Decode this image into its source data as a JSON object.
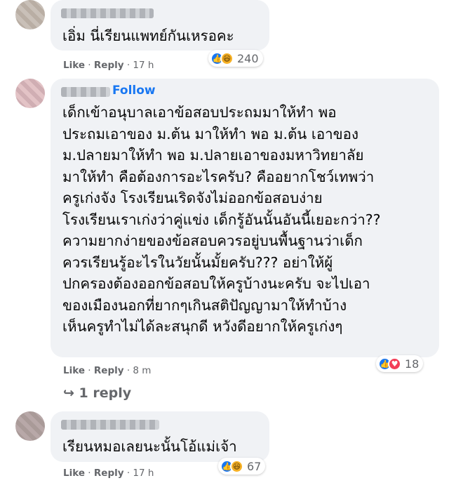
{
  "comments": [
    {
      "text": "เอิ่ม นี่เรียนแพทย์กันเหรอคะ",
      "reaction_count": "240",
      "like_label": "Like",
      "reply_label": "Reply",
      "time": "17 h"
    },
    {
      "follow_label": "Follow",
      "lines": [
        "เด็กเข้าอนุบาลเอาข้อสอบประถมมาให้ทำ พอ",
        "ประถมเอาของ ม.ต้น มาให้ทำ พอ ม.ต้น เอาของ",
        "ม.ปลายมาให้ทำ พอ ม.ปลายเอาของมหาวิทยาลัย",
        "มาให้ทำ คือต้องการอะไรครับ? คืออยากโชว์เทพว่า",
        "ครูเก่งจัง โรงเรียนเริดจังไม่ออกข้อสอบง่าย",
        "โรงเรียนเราเก่งว่าคู่แข่ง เด็กรู้อันนั้นอันนี้เยอะกว่า??",
        "ความยากง่ายของข้อสอบควรอยู่บนพื้นฐานว่าเด็ก",
        "ควรเรียนรู้อะไรในวัยนั้นมั้ยครับ??? อย่าให้ผู้",
        "ปกครองต้องออกข้อสอบให้ครูบ้างนะครับ จะไปเอา",
        "ของเมืองนอกที่ยากๆเกินสติปัญญามาให้ทำบ้าง",
        "เห็นครูทำไม่ได้ละสนุกดี หวังดีอยากให้ครูเก่งๆ"
      ],
      "reaction_count": "18",
      "like_label": "Like",
      "reply_label": "Reply",
      "time": "8 m",
      "replies_label": "1 reply"
    },
    {
      "text": "เรียนหมอเลยนะนั้นโอ้แม่เจ้า",
      "reaction_count": "67",
      "like_label": "Like",
      "reply_label": "Reply",
      "time": "17 h"
    }
  ],
  "colors": {
    "bubble": "#f0f2f5",
    "link": "#1877f2",
    "meta": "#65676b"
  }
}
